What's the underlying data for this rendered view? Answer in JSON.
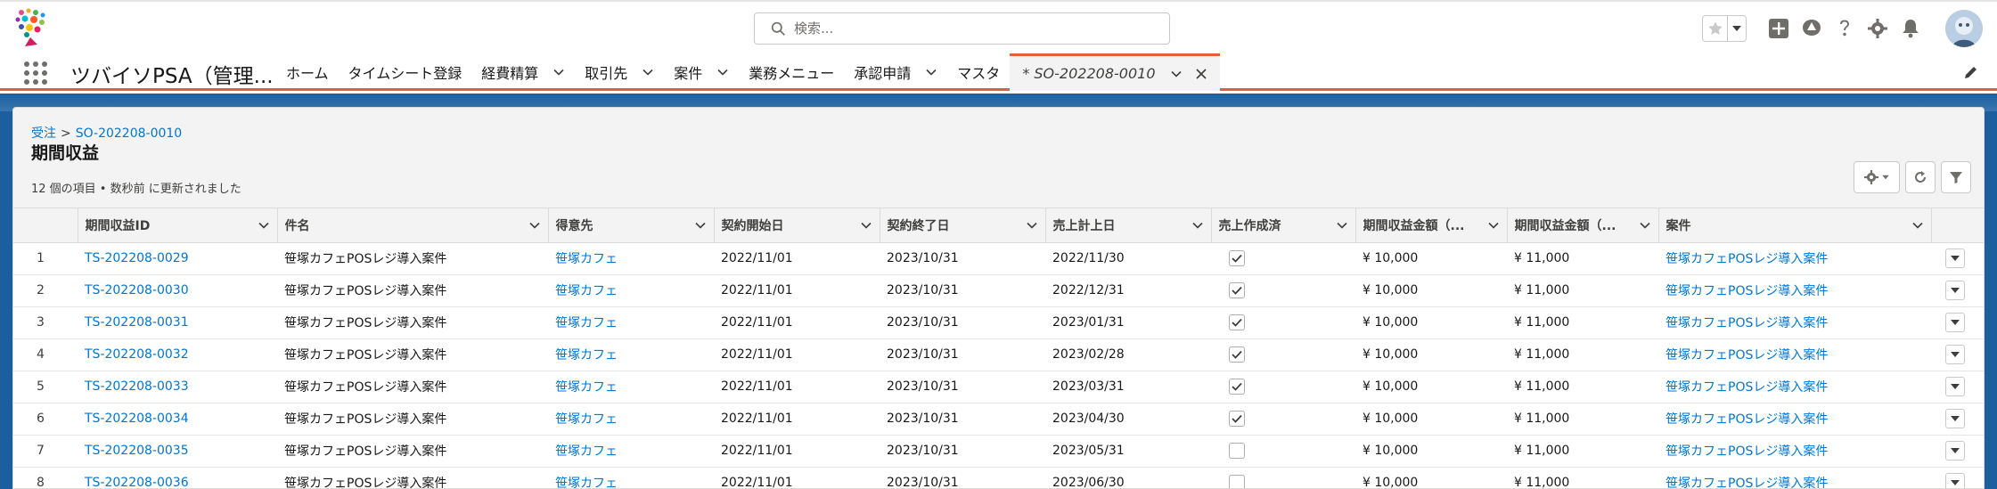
{
  "header": {
    "search_placeholder": "検索..."
  },
  "nav": {
    "app_name": "ツバイソPSA（管理...",
    "items": [
      {
        "label": "ホーム",
        "has_menu": false
      },
      {
        "label": "タイムシート登録",
        "has_menu": false
      },
      {
        "label": "経費精算",
        "has_menu": true
      },
      {
        "label": "取引先",
        "has_menu": true
      },
      {
        "label": "案件",
        "has_menu": true
      },
      {
        "label": "業務メニュー",
        "has_menu": false
      },
      {
        "label": "承認申請",
        "has_menu": true
      },
      {
        "label": "マスタ",
        "has_menu": false
      }
    ],
    "active_tab": "* SO-202208-0010"
  },
  "page": {
    "breadcrumb_parent": "受注",
    "breadcrumb_sep": ">",
    "breadcrumb_record": "SO-202208-0010",
    "title": "期間収益",
    "status": "12 個の項目 • 数秒前 に更新されました"
  },
  "table": {
    "columns": [
      "期間収益ID",
      "件名",
      "得意先",
      "契約開始日",
      "契約終了日",
      "売上計上日",
      "売上作成済",
      "期間収益金額（...",
      "期間収益金額（...",
      "案件"
    ],
    "rows": [
      {
        "num": "1",
        "id": "TS-202208-0029",
        "name": "笹塚カフェPOSレジ導入案件",
        "customer": "笹塚カフェ",
        "start": "2022/11/01",
        "end": "2023/10/31",
        "sales_date": "2022/11/30",
        "created": true,
        "amount1": "¥ 10,000",
        "amount2": "¥ 11,000",
        "project": "笹塚カフェPOSレジ導入案件"
      },
      {
        "num": "2",
        "id": "TS-202208-0030",
        "name": "笹塚カフェPOSレジ導入案件",
        "customer": "笹塚カフェ",
        "start": "2022/11/01",
        "end": "2023/10/31",
        "sales_date": "2022/12/31",
        "created": true,
        "amount1": "¥ 10,000",
        "amount2": "¥ 11,000",
        "project": "笹塚カフェPOSレジ導入案件"
      },
      {
        "num": "3",
        "id": "TS-202208-0031",
        "name": "笹塚カフェPOSレジ導入案件",
        "customer": "笹塚カフェ",
        "start": "2022/11/01",
        "end": "2023/10/31",
        "sales_date": "2023/01/31",
        "created": true,
        "amount1": "¥ 10,000",
        "amount2": "¥ 11,000",
        "project": "笹塚カフェPOSレジ導入案件"
      },
      {
        "num": "4",
        "id": "TS-202208-0032",
        "name": "笹塚カフェPOSレジ導入案件",
        "customer": "笹塚カフェ",
        "start": "2022/11/01",
        "end": "2023/10/31",
        "sales_date": "2023/02/28",
        "created": true,
        "amount1": "¥ 10,000",
        "amount2": "¥ 11,000",
        "project": "笹塚カフェPOSレジ導入案件"
      },
      {
        "num": "5",
        "id": "TS-202208-0033",
        "name": "笹塚カフェPOSレジ導入案件",
        "customer": "笹塚カフェ",
        "start": "2022/11/01",
        "end": "2023/10/31",
        "sales_date": "2023/03/31",
        "created": true,
        "amount1": "¥ 10,000",
        "amount2": "¥ 11,000",
        "project": "笹塚カフェPOSレジ導入案件"
      },
      {
        "num": "6",
        "id": "TS-202208-0034",
        "name": "笹塚カフェPOSレジ導入案件",
        "customer": "笹塚カフェ",
        "start": "2022/11/01",
        "end": "2023/10/31",
        "sales_date": "2023/04/30",
        "created": true,
        "amount1": "¥ 10,000",
        "amount2": "¥ 11,000",
        "project": "笹塚カフェPOSレジ導入案件"
      },
      {
        "num": "7",
        "id": "TS-202208-0035",
        "name": "笹塚カフェPOSレジ導入案件",
        "customer": "笹塚カフェ",
        "start": "2022/11/01",
        "end": "2023/10/31",
        "sales_date": "2023/05/31",
        "created": false,
        "amount1": "¥ 10,000",
        "amount2": "¥ 11,000",
        "project": "笹塚カフェPOSレジ導入案件"
      },
      {
        "num": "8",
        "id": "TS-202208-0036",
        "name": "笹塚カフェPOSレジ導入案件",
        "customer": "笹塚カフェ",
        "start": "2022/11/01",
        "end": "2023/10/31",
        "sales_date": "2023/06/30",
        "created": false,
        "amount1": "¥ 10,000",
        "amount2": "¥ 11,000",
        "project": "笹塚カフェPOSレジ導入案件"
      }
    ]
  },
  "colors": {
    "brand_blue": "#1b5f9e",
    "link": "#0176d3",
    "nav_accent": "#e05f3c"
  }
}
